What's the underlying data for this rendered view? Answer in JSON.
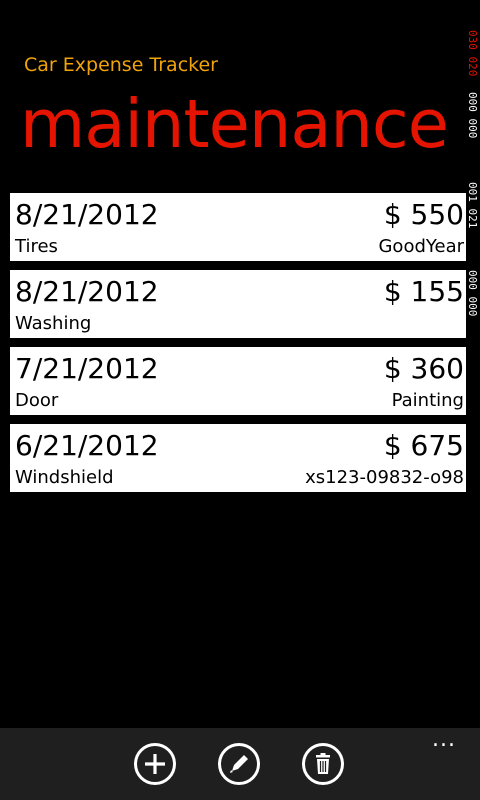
{
  "header": {
    "app_title": "Car Expense Tracker",
    "page_title": "maintenance"
  },
  "expenses": [
    {
      "date": "8/21/2012",
      "amount": "$ 550",
      "category": "Tires",
      "note": "GoodYear"
    },
    {
      "date": "8/21/2012",
      "amount": "$ 155",
      "category": "Washing",
      "note": ""
    },
    {
      "date": "7/21/2012",
      "amount": "$ 360",
      "category": "Door",
      "note": "Painting"
    },
    {
      "date": "6/21/2012",
      "amount": "$ 675",
      "category": "Windshield",
      "note": "xs123-09832-o98"
    }
  ],
  "debug_counters": [
    {
      "text": "030 020",
      "color": "#e51400"
    },
    {
      "text": "000 000",
      "color": "#ffffff"
    },
    {
      "text": "001 021",
      "color": "#ffffff"
    },
    {
      "text": "000 000",
      "color": "#ffffff"
    }
  ],
  "appbar": {
    "buttons": [
      {
        "name": "add-button",
        "icon": "add-icon"
      },
      {
        "name": "edit-button",
        "icon": "edit-icon"
      },
      {
        "name": "delete-button",
        "icon": "delete-icon"
      }
    ],
    "more_label": "..."
  },
  "colors": {
    "background": "#000000",
    "accent_title": "#e51400",
    "app_title": "#f0a30a",
    "item_background": "#ffffff",
    "appbar_background": "#1f1f1f"
  }
}
